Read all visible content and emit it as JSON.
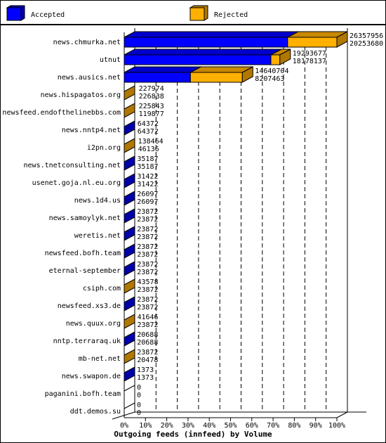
{
  "chart_data": {
    "type": "bar",
    "orientation": "horizontal",
    "stacked": true,
    "style": "3d",
    "title": "Outgoing feeds (innfeed) by Volume",
    "xlabel": "Outgoing feeds (innfeed) by Volume",
    "ylabel": "",
    "xlim": [
      0,
      100
    ],
    "x_unit": "%",
    "x_ticks": [
      "0%",
      "10%",
      "20%",
      "30%",
      "40%",
      "50%",
      "60%",
      "70%",
      "80%",
      "90%",
      "100%"
    ],
    "grid": "vertical dashed",
    "legend_position": "top",
    "legend": [
      {
        "name": "Accepted",
        "color": "#0000ff",
        "side_color": "#0000aa"
      },
      {
        "name": "Rejected",
        "color": "#ffb000",
        "side_color": "#b07800"
      }
    ],
    "categories": [
      "news.chmurka.net",
      "utnut",
      "news.ausics.net",
      "news.hispagatos.org",
      "newsfeed.endofthelinebbs.com",
      "news.nntp4.net",
      "i2pn.org",
      "news.tnetconsulting.net",
      "usenet.goja.nl.eu.org",
      "news.1d4.us",
      "news.samoylyk.net",
      "weretis.net",
      "newsfeed.bofh.team",
      "eternal-september",
      "csiph.com",
      "newsfeed.xs3.de",
      "news.quux.org",
      "nntp.terraraq.uk",
      "mb-net.net",
      "news.swapon.de",
      "paganini.bofh.team",
      "ddt.demos.su"
    ],
    "totals": [
      26357956,
      19293677,
      14640704,
      227974,
      225843,
      64372,
      138464,
      35187,
      31422,
      26097,
      23872,
      23872,
      23872,
      23872,
      43578,
      23872,
      41646,
      20688,
      23872,
      1373,
      0,
      0
    ],
    "series": [
      {
        "name": "Accepted",
        "values": [
          20253680,
          18178137,
          8207463,
          226838,
          119877,
          64372,
          46136,
          35187,
          31422,
          26097,
          23872,
          23872,
          23872,
          23872,
          23872,
          23872,
          23872,
          20688,
          20478,
          1373,
          0,
          0
        ]
      },
      {
        "name": "Rejected",
        "values": [
          6104276,
          1115540,
          6433241,
          1136,
          105966,
          0,
          92328,
          0,
          0,
          0,
          0,
          0,
          0,
          0,
          19706,
          0,
          17774,
          0,
          3394,
          0,
          0,
          0
        ]
      }
    ],
    "scale_max": 26357956
  }
}
